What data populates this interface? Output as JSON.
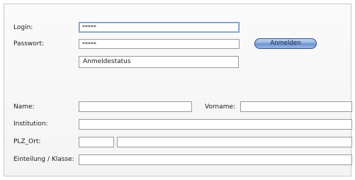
{
  "login": {
    "label": "Login:",
    "value": "*****"
  },
  "password": {
    "label": "Passwort:",
    "value": "*****"
  },
  "login_button": {
    "label": "Anmelden"
  },
  "status": {
    "text": "Anmeldestatus"
  },
  "name": {
    "label": "Name:",
    "value": ""
  },
  "vorname": {
    "label": "Vorname:",
    "value": ""
  },
  "institution": {
    "label": "Institution:",
    "value": ""
  },
  "plz_ort": {
    "label": "PLZ_Ort:",
    "plz_value": "",
    "ort_value": ""
  },
  "einteilung": {
    "label": "Einteilung / Klasse:",
    "value": ""
  }
}
